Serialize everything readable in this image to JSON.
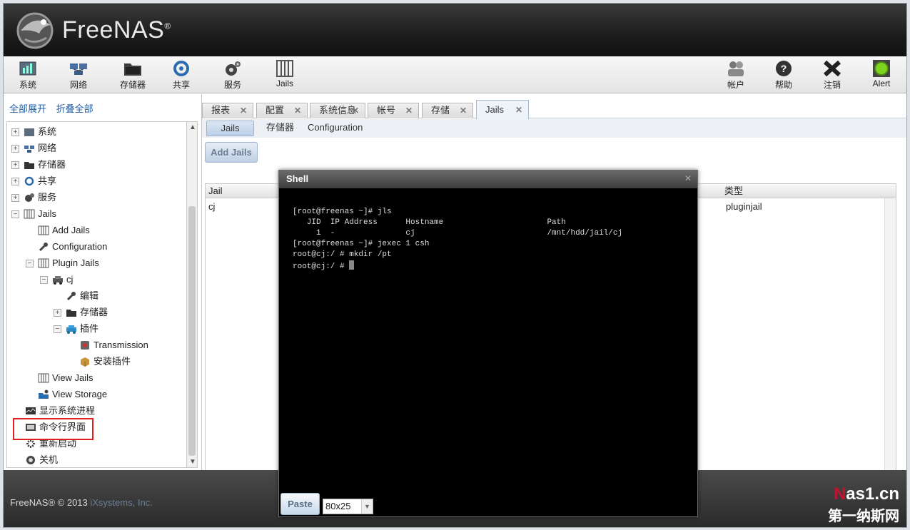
{
  "app": {
    "brand": "FreeNAS",
    "reg": "®"
  },
  "toolbar": {
    "system": "系统",
    "network": "网络",
    "storage": "存储器",
    "sharing": "共享",
    "services": "服务",
    "jails": "Jails",
    "account": "帐户",
    "help": "帮助",
    "logout": "注销",
    "alert": "Alert"
  },
  "sidebar": {
    "expand_all": "全部展开",
    "collapse_all": "折叠全部",
    "items": {
      "system": "系统",
      "network": "网络",
      "storage": "存储器",
      "sharing": "共享",
      "services": "服务",
      "jails": "Jails",
      "add_jails": "Add Jails",
      "configuration": "Configuration",
      "plugin_jails": "Plugin Jails",
      "cj": "cj",
      "edit": "编辑",
      "cj_storage": "存储器",
      "plugins": "插件",
      "transmission": "Transmission",
      "install_plugin": "安装插件",
      "view_jails": "View Jails",
      "view_storage": "View Storage",
      "processes": "显示系统进程",
      "shell": "命令行界面",
      "reboot": "重新启动",
      "shutdown": "关机"
    }
  },
  "tabs": [
    "报表",
    "配置",
    "系统信息",
    "帐号",
    "存储",
    "Jails"
  ],
  "subtabs": [
    "Jails",
    "存储器",
    "Configuration"
  ],
  "add_jails": "Add Jails",
  "grid": {
    "headers": {
      "jail": "Jail",
      "type": "类型"
    },
    "rows": [
      {
        "jail": "cj",
        "type": "pluginjail"
      }
    ]
  },
  "shell": {
    "title": "Shell",
    "lines": [
      "[root@freenas ~]# jls",
      "   JID  IP Address      Hostname                      Path",
      "     1  -               cj                            /mnt/hdd/jail/cj",
      "[root@freenas ~]# jexec 1 csh",
      "root@cj:/ # mkdir /pt",
      "root@cj:/ # "
    ],
    "paste": "Paste",
    "size": "80x25"
  },
  "footer": {
    "copyright": "FreeNAS® © 2013 ",
    "company": "iXsystems, Inc."
  },
  "watermark": {
    "top_n": "N",
    "top_rest": "as1.cn",
    "bottom": "第一纳斯网"
  },
  "colors": {
    "accent": "#1f5fa8",
    "highlight": "#e02020",
    "terminal_bg": "#000000"
  }
}
